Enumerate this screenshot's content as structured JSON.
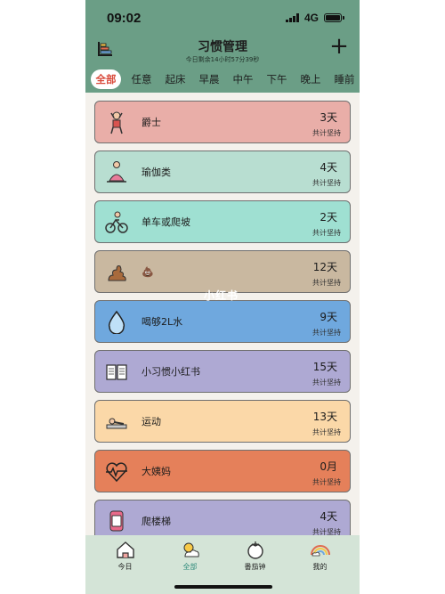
{
  "status": {
    "time": "09:02",
    "network": "4G"
  },
  "header": {
    "title": "习惯管理",
    "subtitle": "今日剩余14小时57分39秒",
    "add_label": "+"
  },
  "tabs": [
    "全部",
    "任意",
    "起床",
    "早晨",
    "中午",
    "下午",
    "晚上",
    "睡前"
  ],
  "active_tab": 0,
  "habits": [
    {
      "name": "爵士",
      "days": "3天",
      "caption": "共计坚持",
      "color": "#e9aea8",
      "icon": "dancer-icon"
    },
    {
      "name": "瑜伽类",
      "days": "4天",
      "caption": "共计坚持",
      "color": "#b8ded1",
      "icon": "yoga-icon"
    },
    {
      "name": "单车或爬坡",
      "days": "2天",
      "caption": "共计坚持",
      "color": "#9fe0d2",
      "icon": "cyclist-icon"
    },
    {
      "name": "💩",
      "days": "12天",
      "caption": "共计坚持",
      "color": "#c9b8a0",
      "icon": "poop-icon"
    },
    {
      "name": "喝够2L水",
      "days": "9天",
      "caption": "共计坚持",
      "color": "#6fa8de",
      "icon": "water-drop-icon"
    },
    {
      "name": "小习惯小红书",
      "days": "15天",
      "caption": "共计坚持",
      "color": "#aea9d3",
      "icon": "book-icon"
    },
    {
      "name": "运动",
      "days": "13天",
      "caption": "共计坚持",
      "color": "#fbd8a8",
      "icon": "exercise-icon"
    },
    {
      "name": "大姨妈",
      "days": "0月",
      "caption": "共计坚持",
      "color": "#e5805a",
      "icon": "heartbeat-icon"
    },
    {
      "name": "爬楼梯",
      "days": "4天",
      "caption": "共计坚持",
      "color": "#aea9d3",
      "icon": "watch-icon"
    }
  ],
  "watermark": "小红书",
  "tabbar": [
    {
      "label": "今日",
      "icon": "house-icon"
    },
    {
      "label": "全部",
      "icon": "sun-cloud-icon"
    },
    {
      "label": "番茄钟",
      "icon": "tomato-icon"
    },
    {
      "label": "我的",
      "icon": "rainbow-icon"
    }
  ],
  "tabbar_active": 1,
  "colors": {
    "header": "#6b9e86",
    "tabbar": "#d4e4d7",
    "active_tab_text": "#d94a3b"
  }
}
